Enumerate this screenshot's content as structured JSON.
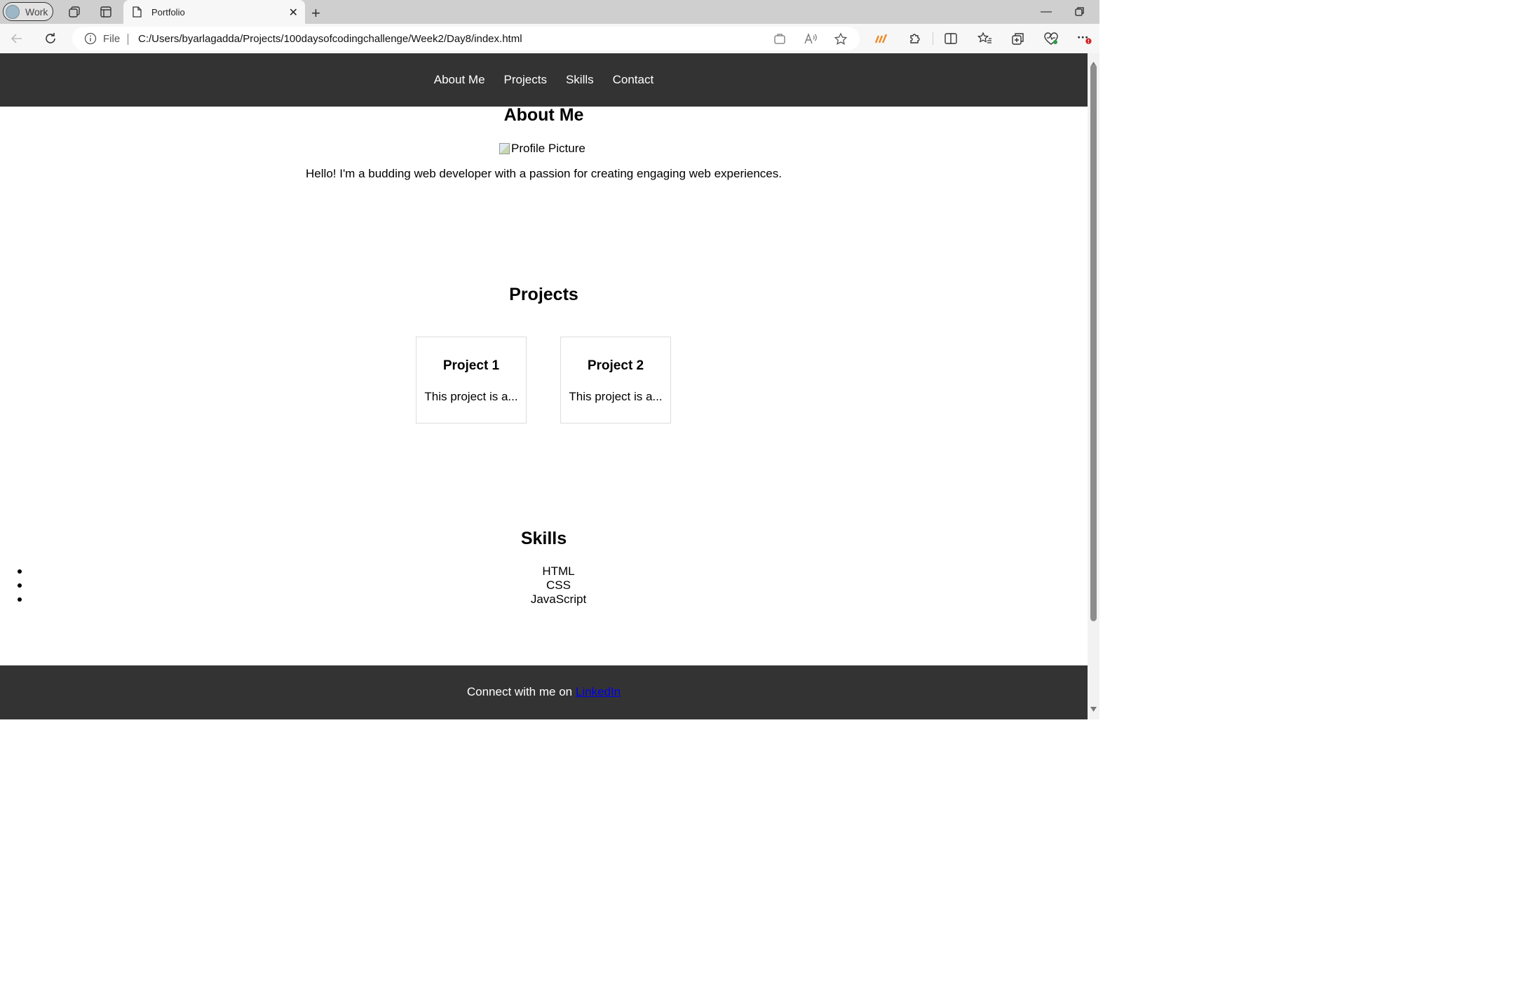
{
  "browser": {
    "profile_label": "Work",
    "tab_title": "Portfolio",
    "address_scheme": "File",
    "url": "C:/Users/byarlagadda/Projects/100daysofcodingchallenge/Week2/Day8/index.html"
  },
  "nav": {
    "items": [
      "About Me",
      "Projects",
      "Skills",
      "Contact"
    ]
  },
  "about": {
    "heading": "About Me",
    "image_alt": "Profile Picture",
    "text": "Hello! I'm a budding web developer with a passion for creating engaging web experiences."
  },
  "projects": {
    "heading": "Projects",
    "items": [
      {
        "title": "Project 1",
        "desc": "This project is a..."
      },
      {
        "title": "Project 2",
        "desc": "This project is a..."
      }
    ]
  },
  "skills": {
    "heading": "Skills",
    "items": [
      "HTML",
      "CSS",
      "JavaScript"
    ]
  },
  "footer": {
    "text": "Connect with me on",
    "link_label": "LinkedIn"
  },
  "colors": {
    "header_bg": "#333333",
    "link": "#0000ee",
    "tabbar_bg": "#cfcfcf"
  }
}
